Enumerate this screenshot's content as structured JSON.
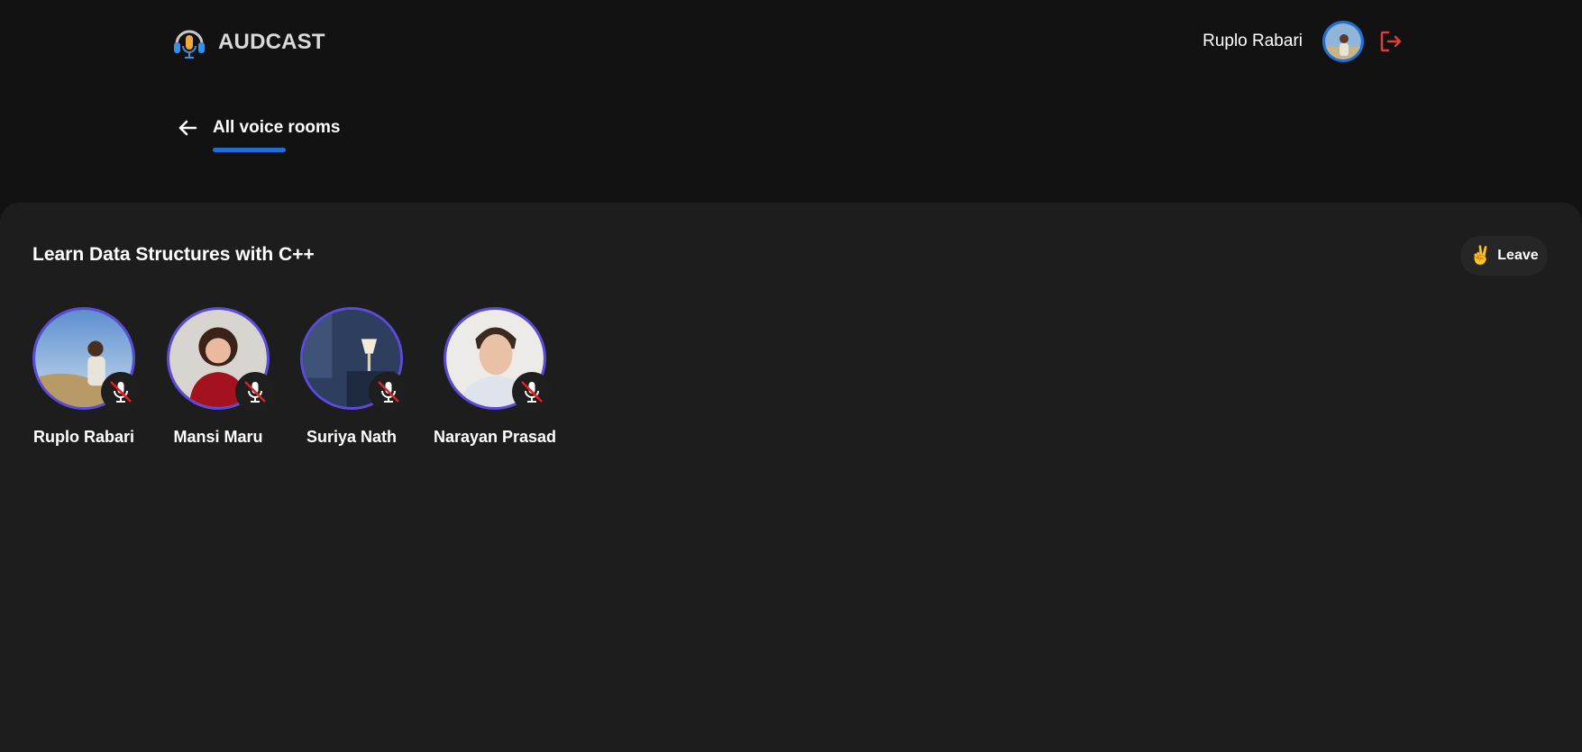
{
  "header": {
    "brand_name": "AUDCAST",
    "user_name": "Ruplo Rabari",
    "icons": {
      "logo": "headphones-mic-icon",
      "avatar": "user-avatar",
      "logout": "logout-icon"
    },
    "colors": {
      "accent": "#1f6fd8",
      "logout": "#e03b3b"
    }
  },
  "nav": {
    "back_icon": "arrow-left-icon",
    "title": "All voice rooms"
  },
  "room": {
    "title": "Learn Data Structures with C++",
    "leave_label": "Leave",
    "leave_emoji": "✌",
    "speakers": [
      {
        "name": "Ruplo Rabari",
        "muted": true
      },
      {
        "name": "Mansi Maru",
        "muted": true
      },
      {
        "name": "Suriya Nath",
        "muted": true
      },
      {
        "name": "Narayan Prasad",
        "muted": true
      }
    ],
    "colors": {
      "avatar_ring": "#5b4bdb",
      "muted_slash": "#e02020"
    }
  }
}
